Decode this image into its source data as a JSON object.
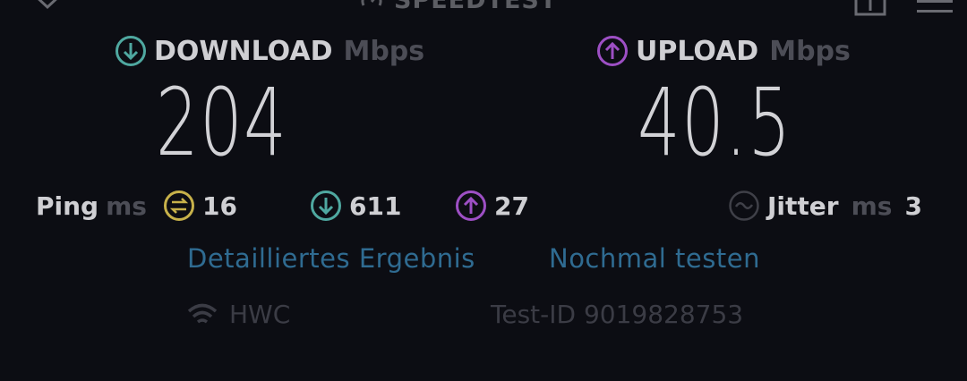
{
  "header": {
    "title": "SPEEDTEST"
  },
  "download": {
    "label": "DOWNLOAD",
    "unit": "Mbps",
    "value": "204"
  },
  "upload": {
    "label": "UPLOAD",
    "unit": "Mbps",
    "value": "40.5"
  },
  "ping": {
    "label": "Ping",
    "unit": "ms",
    "idle": "16",
    "down": "611",
    "up": "27"
  },
  "jitter": {
    "label": "Jitter",
    "unit": "ms",
    "value": "3"
  },
  "actions": {
    "detail": "Detailliertes Ergebnis",
    "retest": "Nochmal testen"
  },
  "footer": {
    "network": "HWC",
    "test_id": "Test-ID 9019828753"
  },
  "colors": {
    "download": "#4fa8a0",
    "upload": "#9d4fc4",
    "ping": "#c7b14a",
    "link": "#2f6b91"
  }
}
